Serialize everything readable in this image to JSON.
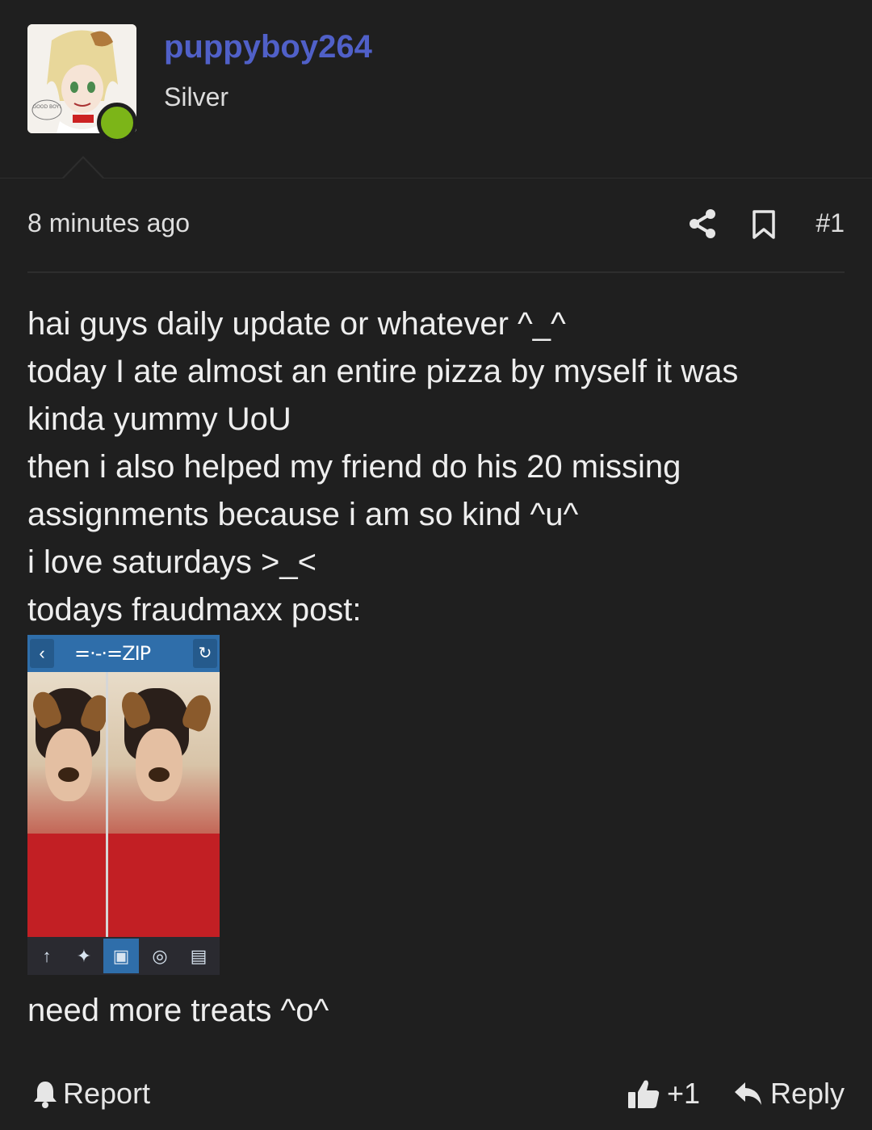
{
  "author": {
    "username": "puppyboy264",
    "rank": "Silver",
    "online": true,
    "avatar_text": "GOOD BOY!"
  },
  "post": {
    "timestamp": "8 minutes ago",
    "number": "#1",
    "lines": [
      "hai guys daily update or whatever ^_^",
      "today I ate almost an entire pizza by myself it was",
      "kinda yummy UoU",
      "then i also helped my friend do his 20 missing",
      "assignments because i am so kind ^u^",
      "i love saturdays >_<",
      "todays fraudmaxx post:"
    ],
    "attachment": {
      "title": "=·-·=ZIP",
      "back_glyph": "‹",
      "refresh_glyph": "↻",
      "tab_icons": [
        "↑",
        "✦",
        "▣",
        "◎",
        "▤"
      ]
    },
    "closing_line": "need more treats ^o^"
  },
  "actions": {
    "report_label": "Report",
    "like_count": "+1",
    "reply_label": "Reply"
  },
  "colors": {
    "background": "#1f1f1f",
    "username": "#5060c8",
    "online": "#7cb518",
    "attachment_bar": "#2f6eaa"
  },
  "icons": [
    "share-icon",
    "bookmark-icon",
    "bell-icon",
    "thumbs-up-icon",
    "reply-icon"
  ]
}
